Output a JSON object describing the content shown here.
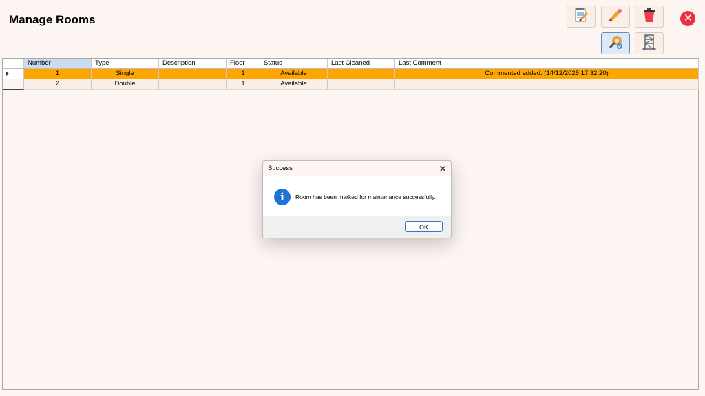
{
  "page": {
    "title": "Manage Rooms"
  },
  "toolbar": {
    "buttons": [
      {
        "name": "notes-icon"
      },
      {
        "name": "pencil-icon"
      },
      {
        "name": "trash-icon"
      },
      {
        "name": "maintenance-icon",
        "active": true
      },
      {
        "name": "scaffold-icon"
      }
    ]
  },
  "grid": {
    "columns": [
      "Number",
      "Type",
      "Description",
      "Floor",
      "Status",
      "Last Cleaned",
      "Last Comment"
    ],
    "rows": [
      {
        "number": "1",
        "type": "Single",
        "description": "",
        "floor": "1",
        "status": "Available",
        "last_cleaned": "",
        "last_comment": "Commented added. (14/12/2025 17:32:20)"
      },
      {
        "number": "2",
        "type": "Double",
        "description": "",
        "floor": "1",
        "status": "Available",
        "last_cleaned": "",
        "last_comment": ""
      }
    ]
  },
  "dialog": {
    "title": "Success",
    "message": "Room has been marked for maintenance successfully.",
    "ok_label": "OK",
    "close_glyph": "✕",
    "info_glyph": "i"
  },
  "colors": {
    "selected_row": "#ffa500",
    "background": "#fdf5f1",
    "close_red": "#e8323f",
    "info_blue": "#1e74d2"
  }
}
